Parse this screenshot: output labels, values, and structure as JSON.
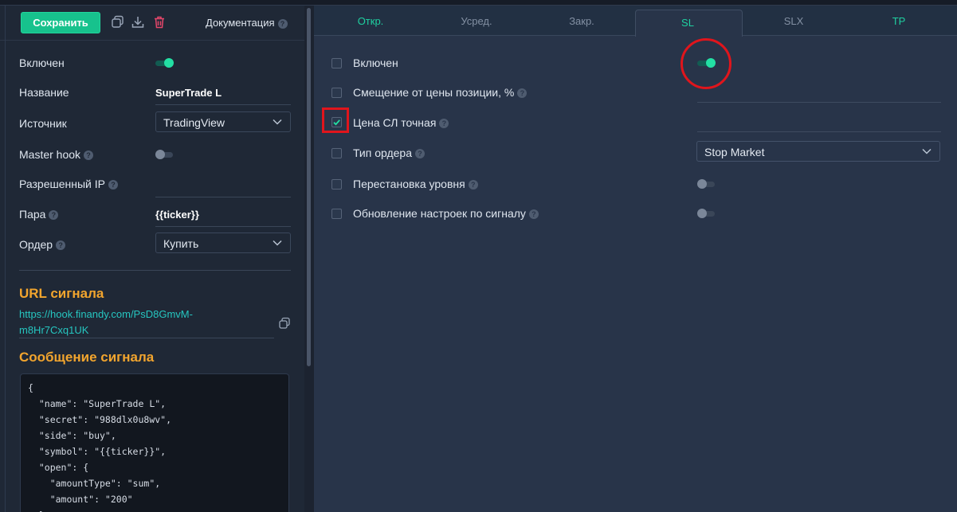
{
  "toolbar": {
    "save_label": "Сохранить",
    "docs_label": "Документация"
  },
  "left": {
    "rows": {
      "enabled": {
        "label": "Включен",
        "toggle_on": true
      },
      "name": {
        "label": "Название",
        "value": "SuperTrade L"
      },
      "source": {
        "label": "Источник",
        "value": "TradingView"
      },
      "master_hook": {
        "label": "Master hook",
        "toggle_on": false
      },
      "allowed_ip": {
        "label": "Разрешенный IP",
        "value": ""
      },
      "pair": {
        "label": "Пара",
        "value": "{{ticker}}"
      },
      "order": {
        "label": "Ордер",
        "value": "Купить"
      }
    },
    "url_title": "URL сигнала",
    "url_value": "https://hook.finandy.com/PsD8GmvM-m8Hr7Cxq1UK",
    "message_title": "Сообщение сигнала",
    "message_code": "{\n  \"name\": \"SuperTrade L\",\n  \"secret\": \"988dlx0u8wv\",\n  \"side\": \"buy\",\n  \"symbol\": \"{{ticker}}\",\n  \"open\": {\n    \"amountType\": \"sum\",\n    \"amount\": \"200\"\n  },"
  },
  "tabs": [
    {
      "label": "Откр.",
      "color": "#1fd0a0"
    },
    {
      "label": "Усред.",
      "color": "#8390a3"
    },
    {
      "label": "Закр.",
      "color": "#8390a3"
    },
    {
      "label": "SL",
      "color": "#1fd0a0",
      "active": true
    },
    {
      "label": "SLX",
      "color": "#8390a3"
    },
    {
      "label": "TP",
      "color": "#1fd0a0"
    }
  ],
  "right": {
    "rows": {
      "enabled": {
        "label": "Включен",
        "checked": false,
        "toggle_on": true
      },
      "offset": {
        "label": "Смещение от цены позиции, %",
        "checked": false
      },
      "exact_price": {
        "label": "Цена СЛ точная",
        "checked": true
      },
      "order_type": {
        "label": "Тип ордера",
        "checked": false,
        "value": "Stop Market"
      },
      "level_shift": {
        "label": "Перестановка уровня",
        "checked": false,
        "toggle_on": false
      },
      "signal_update": {
        "label": "Обновление настроек по сигналу",
        "checked": false,
        "toggle_on": false
      }
    }
  },
  "help_glyph": "?",
  "colors": {
    "accent_green": "#17c28d",
    "toggle_on": "#23e0a4",
    "section_title": "#f2a52e",
    "link": "#26c6c0",
    "highlight_red": "#e0151c"
  }
}
